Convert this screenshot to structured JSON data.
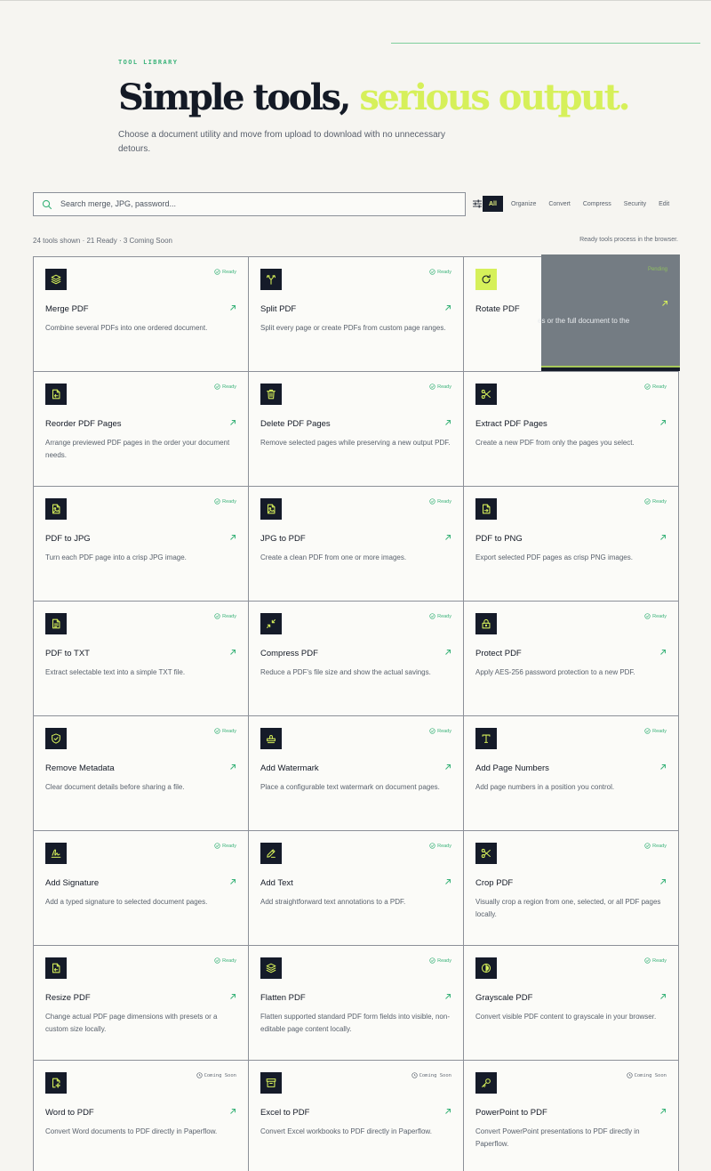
{
  "header": {
    "eyebrow": "TOOL LIBRARY",
    "title_dark": "Simple tools,",
    "title_accent": "serious output.",
    "subtitle": "Choose a document utility and move from upload to download with no unnecessary detours."
  },
  "search": {
    "placeholder": "Search merge, JPG, password..."
  },
  "filters": [
    "All",
    "Organize",
    "Convert",
    "Compress",
    "Security",
    "Edit"
  ],
  "filter_active": "All",
  "summary": {
    "count": "24 tools shown · 21 Ready · 3 Coming Soon",
    "note": "Ready tools process in the browser."
  },
  "colors": {
    "accent_lime": "#d6f05a",
    "ready_green": "#3bb37a",
    "ink": "#151b29"
  },
  "tools": [
    {
      "name": "Merge PDF",
      "desc": "Combine several PDFs into one ordered document.",
      "status": "Ready",
      "icon": "layers-icon"
    },
    {
      "name": "Split PDF",
      "desc": "Split every page or create PDFs from custom page ranges.",
      "status": "Ready",
      "icon": "split-icon"
    },
    {
      "name": "Rotate PDF",
      "desc": "",
      "status": "",
      "icon": "rotate-icon",
      "hover_label": "Pending",
      "hover_text": "es or the full document to the"
    },
    {
      "name": "Reorder PDF Pages",
      "desc": "Arrange previewed PDF pages in the order your document needs.",
      "status": "Ready",
      "icon": "reorder-icon"
    },
    {
      "name": "Delete PDF Pages",
      "desc": "Remove selected pages while preserving a new output PDF.",
      "status": "Ready",
      "icon": "trash-icon"
    },
    {
      "name": "Extract PDF Pages",
      "desc": "Create a new PDF from only the pages you select.",
      "status": "Ready",
      "icon": "scissors-icon"
    },
    {
      "name": "PDF to JPG",
      "desc": "Turn each PDF page into a crisp JPG image.",
      "status": "Ready",
      "icon": "image-file-icon"
    },
    {
      "name": "JPG to PDF",
      "desc": "Create a clean PDF from one or more images.",
      "status": "Ready",
      "icon": "image-file-icon"
    },
    {
      "name": "PDF to PNG",
      "desc": "Export selected PDF pages as crisp PNG images.",
      "status": "Ready",
      "icon": "export-file-icon"
    },
    {
      "name": "PDF to TXT",
      "desc": "Extract selectable text into a simple TXT file.",
      "status": "Ready",
      "icon": "text-file-icon"
    },
    {
      "name": "Compress PDF",
      "desc": "Reduce a PDF's file size and show the actual savings.",
      "status": "Ready",
      "icon": "compress-icon"
    },
    {
      "name": "Protect PDF",
      "desc": "Apply AES-256 password protection to a new PDF.",
      "status": "Ready",
      "icon": "lock-icon"
    },
    {
      "name": "Remove Metadata",
      "desc": "Clear document details before sharing a file.",
      "status": "Ready",
      "icon": "shield-icon"
    },
    {
      "name": "Add Watermark",
      "desc": "Place a configurable text watermark on document pages.",
      "status": "Ready",
      "icon": "stamp-icon"
    },
    {
      "name": "Add Page Numbers",
      "desc": "Add page numbers in a position you control.",
      "status": "Ready",
      "icon": "type-icon"
    },
    {
      "name": "Add Signature",
      "desc": "Add a typed signature to selected document pages.",
      "status": "Ready",
      "icon": "signature-icon"
    },
    {
      "name": "Add Text",
      "desc": "Add straightforward text annotations to a PDF.",
      "status": "Ready",
      "icon": "pen-icon"
    },
    {
      "name": "Crop PDF",
      "desc": "Visually crop a region from one, selected, or all PDF pages locally.",
      "status": "Ready",
      "icon": "scissors-icon"
    },
    {
      "name": "Resize PDF",
      "desc": "Change actual PDF page dimensions with presets or a custom size locally.",
      "status": "Ready",
      "icon": "resize-file-icon"
    },
    {
      "name": "Flatten PDF",
      "desc": "Flatten supported standard PDF form fields into visible, non-editable page content locally.",
      "status": "Ready",
      "icon": "layers-icon"
    },
    {
      "name": "Grayscale PDF",
      "desc": "Convert visible PDF content to grayscale in your browser.",
      "status": "Ready",
      "icon": "contrast-icon"
    },
    {
      "name": "Word to PDF",
      "desc": "Convert Word documents to PDF directly in Paperflow.",
      "status": "Coming Soon",
      "icon": "file-cog-icon"
    },
    {
      "name": "Excel to PDF",
      "desc": "Convert Excel workbooks to PDF directly in Paperflow.",
      "status": "Coming Soon",
      "icon": "archive-icon"
    },
    {
      "name": "PowerPoint to PDF",
      "desc": "Convert PowerPoint presentations to PDF directly in Paperflow.",
      "status": "Coming Soon",
      "icon": "key-icon"
    }
  ]
}
